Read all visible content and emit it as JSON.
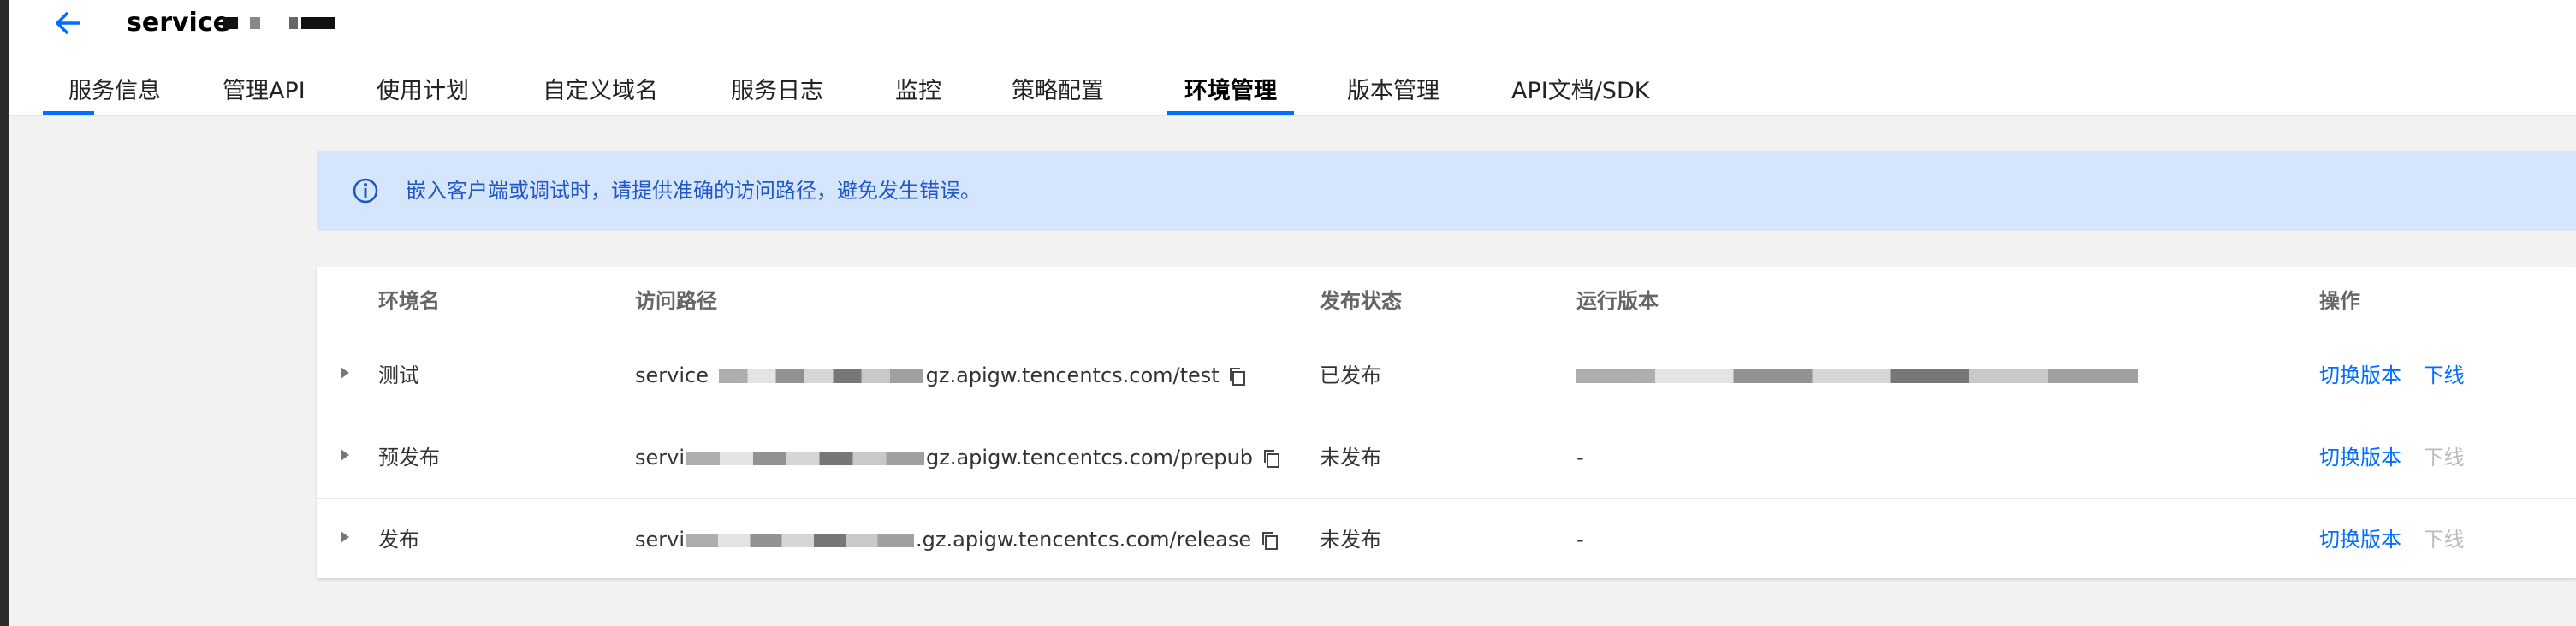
{
  "header": {
    "title": "service",
    "back_icon": "arrow-left-icon"
  },
  "tabs": [
    {
      "label": "服务信息",
      "active": false
    },
    {
      "label": "管理API",
      "active": false
    },
    {
      "label": "使用计划",
      "active": false
    },
    {
      "label": "自定义域名",
      "active": false
    },
    {
      "label": "服务日志",
      "active": false
    },
    {
      "label": "监控",
      "active": false
    },
    {
      "label": "策略配置",
      "active": false
    },
    {
      "label": "环境管理",
      "active": true
    },
    {
      "label": "版本管理",
      "active": false
    },
    {
      "label": "API文档/SDK",
      "active": false
    }
  ],
  "notice": {
    "icon": "info-icon",
    "text": "嵌入客户端或调试时，请提供准确的访问路径，避免发生错误。"
  },
  "table": {
    "columns": [
      "环境名",
      "访问路径",
      "发布状态",
      "运行版本",
      "操作"
    ],
    "rows": [
      {
        "env": "测试",
        "path_prefix": "service",
        "path_suffix": "gz.apigw.tencentcs.com/test",
        "status": "已发布",
        "version": "",
        "switch": "切换版本",
        "offline": "下线",
        "offline_enabled": true
      },
      {
        "env": "预发布",
        "path_prefix": "servi",
        "path_suffix": "gz.apigw.tencentcs.com/prepub",
        "status": "未发布",
        "version": "-",
        "switch": "切换版本",
        "offline": "下线",
        "offline_enabled": false
      },
      {
        "env": "发布",
        "path_prefix": "servi",
        "path_suffix": ".gz.apigw.tencentcs.com/release",
        "status": "未发布",
        "version": "-",
        "switch": "切换版本",
        "offline": "下线",
        "offline_enabled": false
      }
    ]
  },
  "colors": {
    "accent": "#006eff",
    "notice_bg": "#d5e5fc",
    "disabled": "#bbbbbb"
  }
}
